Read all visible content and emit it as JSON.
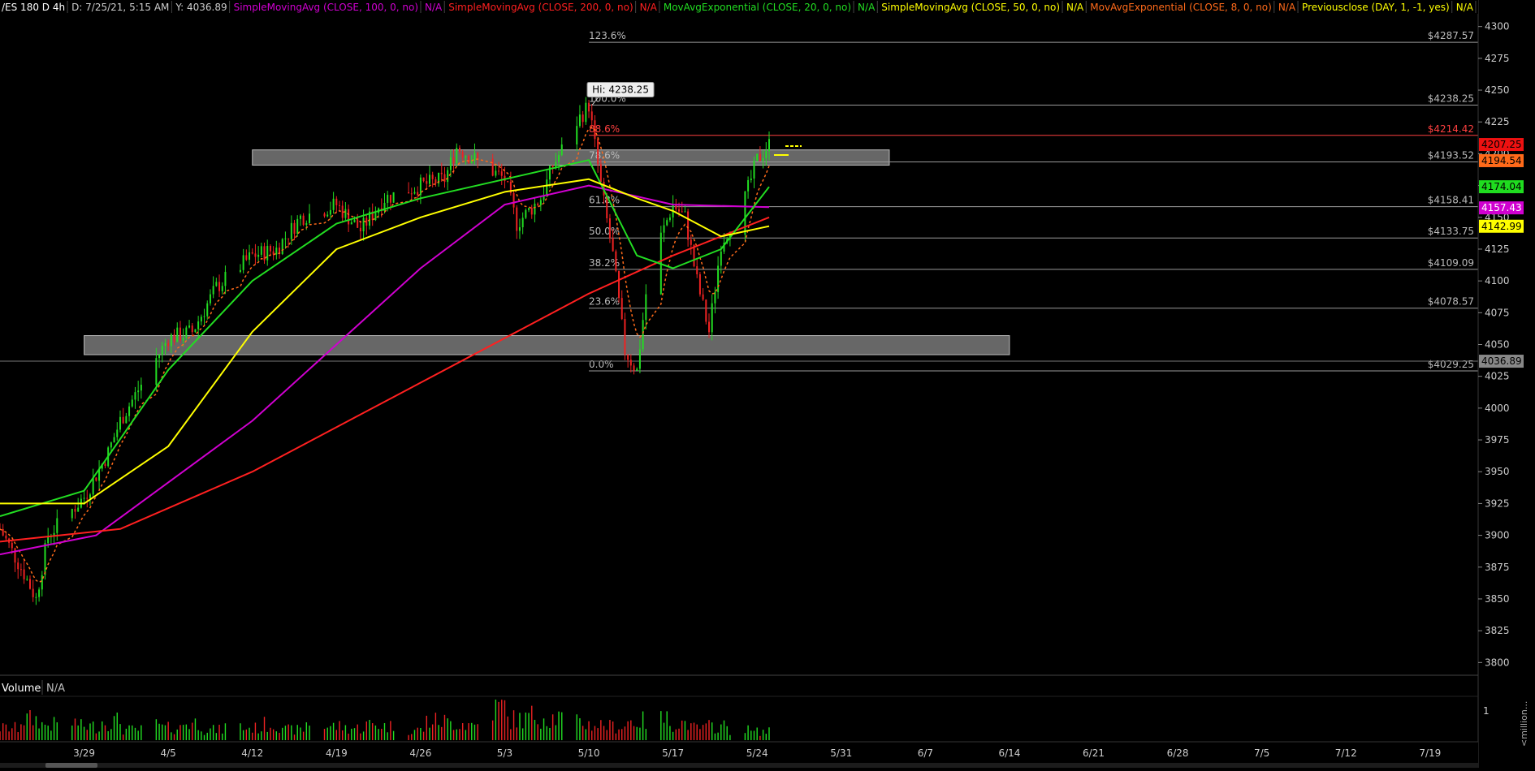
{
  "header": {
    "symbol": "/ES 180 D 4h",
    "date": "D: 7/25/21, 5:15 AM",
    "y_readout": "Y: 4036.89",
    "studies": [
      {
        "label": "SimpleMovingAvg (CLOSE, 100, 0, no)",
        "value": "N/A",
        "color": "#d000d0"
      },
      {
        "label": "SimpleMovingAvg (CLOSE, 200, 0, no)",
        "value": "N/A",
        "color": "#ff2020"
      },
      {
        "label": "MovAvgExponential (CLOSE, 20, 0, no)",
        "value": "N/A",
        "color": "#22dd22"
      },
      {
        "label": "SimpleMovingAvg (CLOSE, 50, 0, no)",
        "value": "N/A",
        "color": "#ffff00"
      },
      {
        "label": "MovAvgExponential (CLOSE, 8, 0, no)",
        "value": "N/A",
        "color": "#ff6a1a"
      },
      {
        "label": "Previousclose (DAY, 1, -1, yes)",
        "value": "N/A",
        "color": "#ffff00"
      }
    ]
  },
  "volume_panel": {
    "title": "Volume",
    "value": "N/A",
    "scale_top": "1",
    "scale_unit": "<million..."
  },
  "chart_data": {
    "type": "candlestick",
    "title": "/ES 180 D 4h",
    "ylim": [
      3790,
      4310
    ],
    "y_ticks": [
      4300,
      4275,
      4250,
      4225,
      4200,
      4175,
      4150,
      4125,
      4100,
      4075,
      4050,
      4025,
      4000,
      3975,
      3950,
      3925,
      3900,
      3875,
      3850,
      3825,
      3800
    ],
    "x_range_days": [
      "2021-03-22",
      "2021-07-23"
    ],
    "x_ticks": [
      "3/29",
      "4/5",
      "4/12",
      "4/19",
      "4/26",
      "5/3",
      "5/10",
      "5/17",
      "5/24",
      "5/31",
      "6/7",
      "6/14",
      "6/21",
      "6/28",
      "7/5",
      "7/12",
      "7/19"
    ],
    "price_path": [
      [
        "2021-03-22",
        3905
      ],
      [
        "2021-03-24",
        3870
      ],
      [
        "2021-03-25",
        3850
      ],
      [
        "2021-03-26",
        3900
      ],
      [
        "2021-03-29",
        3930
      ],
      [
        "2021-03-31",
        3965
      ],
      [
        "2021-04-01",
        3990
      ],
      [
        "2021-04-05",
        4055
      ],
      [
        "2021-04-07",
        4060
      ],
      [
        "2021-04-09",
        4095
      ],
      [
        "2021-04-12",
        4120
      ],
      [
        "2021-04-14",
        4125
      ],
      [
        "2021-04-16",
        4150
      ],
      [
        "2021-04-19",
        4160
      ],
      [
        "2021-04-21",
        4140
      ],
      [
        "2021-04-23",
        4165
      ],
      [
        "2021-04-26",
        4175
      ],
      [
        "2021-04-28",
        4180
      ],
      [
        "2021-04-29",
        4205
      ],
      [
        "2021-05-03",
        4180
      ],
      [
        "2021-05-04",
        4145
      ],
      [
        "2021-05-06",
        4165
      ],
      [
        "2021-05-07",
        4190
      ],
      [
        "2021-05-09",
        4225
      ],
      [
        "2021-05-10",
        4238.25
      ],
      [
        "2021-05-11",
        4175
      ],
      [
        "2021-05-12",
        4120
      ],
      [
        "2021-05-13",
        4045
      ],
      [
        "2021-05-14",
        4029.25
      ],
      [
        "2021-05-15",
        4110
      ],
      [
        "2021-05-17",
        4160
      ],
      [
        "2021-05-18",
        4150
      ],
      [
        "2021-05-19",
        4100
      ],
      [
        "2021-05-20",
        4060
      ],
      [
        "2021-05-21",
        4130
      ],
      [
        "2021-05-23",
        4165
      ],
      [
        "2021-05-24",
        4195
      ],
      [
        "2021-05-25",
        4207.25
      ]
    ],
    "volume": [
      0.35,
      0.6,
      0.45,
      0.5,
      0.4,
      0.55,
      0.3,
      0.45,
      0.35,
      0.5,
      0.3,
      0.4,
      0.35,
      0.45,
      0.3,
      0.5,
      0.4,
      0.35,
      0.45,
      0.4,
      0.3,
      0.55,
      0.5,
      0.45,
      0.95,
      0.6,
      0.7,
      0.65,
      0.5,
      0.45,
      0.4,
      0.55,
      0.6,
      0.5,
      0.35,
      0.4,
      0.3,
      0.25
    ],
    "series": [
      {
        "name": "SimpleMovingAvg (CLOSE, 100, 0, no)",
        "color": "#d000d0",
        "points": [
          [
            "2021-03-22",
            3885
          ],
          [
            "2021-03-30",
            3900
          ],
          [
            "2021-04-12",
            3990
          ],
          [
            "2021-04-19",
            4050
          ],
          [
            "2021-04-26",
            4110
          ],
          [
            "2021-05-03",
            4160
          ],
          [
            "2021-05-10",
            4175
          ],
          [
            "2021-05-17",
            4160
          ],
          [
            "2021-05-25",
            4158
          ]
        ]
      },
      {
        "name": "SimpleMovingAvg (CLOSE, 200, 0, no)",
        "color": "#ff2020",
        "points": [
          [
            "2021-03-22",
            3895
          ],
          [
            "2021-04-01",
            3905
          ],
          [
            "2021-04-12",
            3950
          ],
          [
            "2021-04-26",
            4020
          ],
          [
            "2021-05-10",
            4090
          ],
          [
            "2021-05-17",
            4120
          ],
          [
            "2021-05-25",
            4150
          ]
        ]
      },
      {
        "name": "MovAvgExponential (CLOSE, 20, 0, no)",
        "color": "#22dd22",
        "points": [
          [
            "2021-03-22",
            3915
          ],
          [
            "2021-03-29",
            3935
          ],
          [
            "2021-04-05",
            4030
          ],
          [
            "2021-04-12",
            4100
          ],
          [
            "2021-04-19",
            4145
          ],
          [
            "2021-04-26",
            4165
          ],
          [
            "2021-05-03",
            4180
          ],
          [
            "2021-05-10",
            4195
          ],
          [
            "2021-05-14",
            4120
          ],
          [
            "2021-05-17",
            4110
          ],
          [
            "2021-05-21",
            4125
          ],
          [
            "2021-05-25",
            4174
          ]
        ]
      },
      {
        "name": "SimpleMovingAvg (CLOSE, 50, 0, no)",
        "color": "#ffff00",
        "points": [
          [
            "2021-03-22",
            3925
          ],
          [
            "2021-03-29",
            3925
          ],
          [
            "2021-04-05",
            3970
          ],
          [
            "2021-04-12",
            4060
          ],
          [
            "2021-04-19",
            4125
          ],
          [
            "2021-04-26",
            4150
          ],
          [
            "2021-05-03",
            4170
          ],
          [
            "2021-05-10",
            4180
          ],
          [
            "2021-05-14",
            4165
          ],
          [
            "2021-05-17",
            4155
          ],
          [
            "2021-05-21",
            4135
          ],
          [
            "2021-05-25",
            4143
          ]
        ]
      }
    ],
    "ema8_color": "#ff6a1a",
    "fib_levels": [
      {
        "label": "123.6%",
        "price_label": "$4287.57",
        "value": 4287.57
      },
      {
        "label": "100.0%",
        "price_label": "$4238.25",
        "value": 4238.25
      },
      {
        "label": "88.6%",
        "price_label": "$4214.42",
        "value": 4214.42,
        "color": "#ff4040"
      },
      {
        "label": "78.6%",
        "price_label": "$4193.52",
        "value": 4193.52
      },
      {
        "label": "61.8%",
        "price_label": "$4158.41",
        "value": 4158.41
      },
      {
        "label": "50.0%",
        "price_label": "$4133.75",
        "value": 4133.75
      },
      {
        "label": "38.2%",
        "price_label": "$4109.09",
        "value": 4109.09
      },
      {
        "label": "23.6%",
        "price_label": "$4078.57",
        "value": 4078.57
      },
      {
        "label": "0.0%",
        "price_label": "$4029.25",
        "value": 4029.25
      }
    ],
    "fib_start_date": "2021-05-10",
    "zones": [
      {
        "from": "2021-04-12",
        "to": "2021-06-04",
        "low": 4191,
        "high": 4203
      },
      {
        "from": "2021-03-29",
        "to": "2021-06-14",
        "low": 4042,
        "high": 4057
      }
    ],
    "hi_callout": {
      "text": "Hi: 4238.25",
      "date": "2021-05-10",
      "value": 4238.25
    },
    "crosshair_y": 4036.89,
    "right_badges": [
      {
        "text": "4207.25",
        "value": 4207.25,
        "bg": "#ee1111",
        "fg": "#000000"
      },
      {
        "text": "4194.54",
        "value": 4194.54,
        "bg": "#ff6a1a",
        "fg": "#000000"
      },
      {
        "text": "4174.04",
        "value": 4174.04,
        "bg": "#1fdc1f",
        "fg": "#000000"
      },
      {
        "text": "4157.43",
        "value": 4157.43,
        "bg": "#d000d0",
        "fg": "#ffffff"
      },
      {
        "text": "4142.99",
        "value": 4142.99,
        "bg": "#ffff00",
        "fg": "#000000"
      },
      {
        "text": "4036.89",
        "value": 4036.89,
        "bg": "#888888",
        "fg": "#000000"
      }
    ],
    "prev_close_value": 4199
  }
}
